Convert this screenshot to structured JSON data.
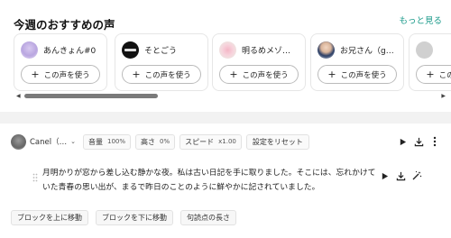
{
  "recommend": {
    "title": "今週のおすすめの声",
    "more_label": "もっと見る",
    "voices": [
      {
        "name": "あんきょん#0",
        "avatar": "anime-girl-avatar"
      },
      {
        "name": "そとごう",
        "avatar": "dark-logo-avatar"
      },
      {
        "name": "明るめメゾ…",
        "avatar": "flower-avatar"
      },
      {
        "name": "お兄さん（g…",
        "avatar": "man-avatar"
      },
      {
        "name": "",
        "avatar": "grey-avatar"
      }
    ],
    "use_label": "この声を使う"
  },
  "editor": {
    "speaker_name": "Canel（…",
    "volume_label": "音量",
    "volume_value": "100%",
    "pitch_label": "高さ",
    "pitch_value": "0%",
    "speed_label": "スピード",
    "speed_value": "x1.00",
    "reset_label": "設定をリセット",
    "text": "月明かりが窓から差し込む静かな夜。私は古い日記を手に取りました。そこには、忘れかけていた青春の思い出が、まるで昨日のことのように鮮やかに記されていました。",
    "actions": [
      "ブロックを上に移動",
      "ブロックを下に移動",
      "句読点の長さ"
    ]
  },
  "colors": {
    "accent": "#1a9a8a",
    "scroll_thumb": "#7a7a7a"
  }
}
